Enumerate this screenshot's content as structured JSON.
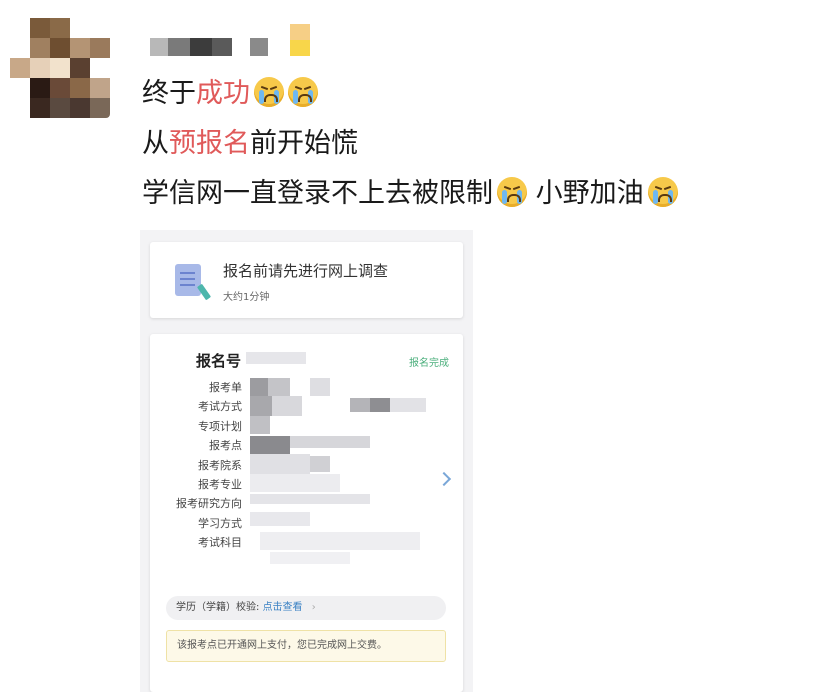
{
  "post": {
    "lines": [
      {
        "plain_before": "终于",
        "highlight": "成功",
        "plain_after": ""
      },
      {
        "plain_before": "从",
        "highlight": "预报名",
        "plain_after": "前开始慌"
      },
      {
        "plain_before": "学信网一直登录不上去被限制",
        "highlight": "",
        "plain_after": " 小野加油"
      }
    ],
    "emoji_name": "crying-face-icon",
    "highlight_color": "#e05a5a"
  },
  "screenshot": {
    "survey_card": {
      "title": "报名前请先进行网上调查",
      "subtitle": "大约1分钟"
    },
    "registration_card": {
      "title": "报名号",
      "status": "报名完成",
      "field_labels": [
        "报考单",
        "考试方式",
        "专项计划",
        "报考点",
        "报考院系",
        "报考专业",
        "报考研究方向",
        "学习方式",
        "考试科目"
      ],
      "verify_label": "学历（学籍）校验:",
      "verify_link": "点击查看",
      "notice": "该报考点已开通网上支付，您已完成网上交费。"
    }
  }
}
